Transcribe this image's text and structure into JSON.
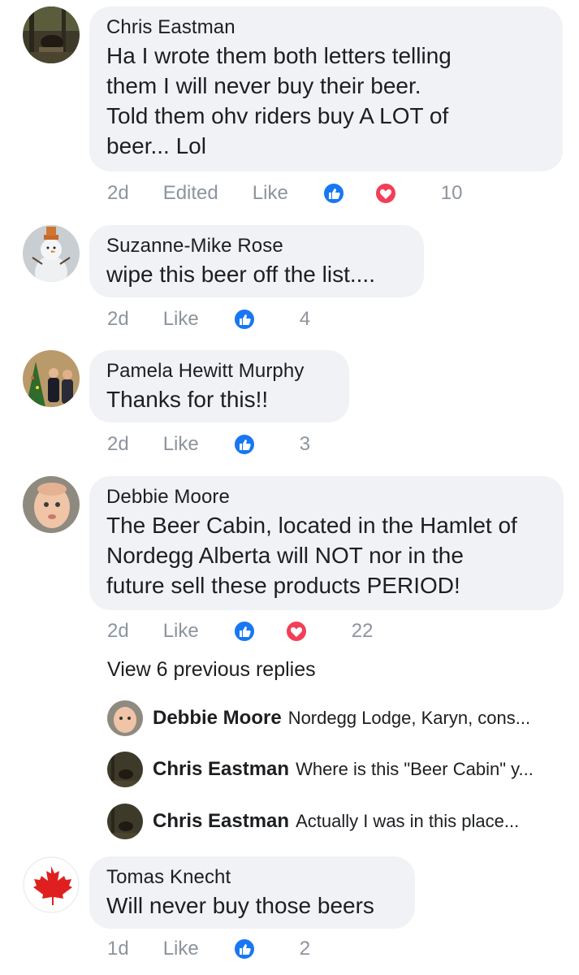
{
  "comments": [
    {
      "author": "Chris Eastman",
      "lines": [
        "Ha I wrote them both letters telling",
        "them I will never buy their beer.",
        "Told them ohv riders buy A LOT of",
        "beer... Lol"
      ],
      "time": "2d",
      "edited": "Edited",
      "like": "Like",
      "reaction_count": "10"
    },
    {
      "author": "Suzanne-Mike Rose",
      "lines": [
        "wipe this beer off the list...."
      ],
      "time": "2d",
      "like": "Like",
      "reaction_count": "4"
    },
    {
      "author": "Pamela Hewitt Murphy",
      "lines": [
        "Thanks for this!!"
      ],
      "time": "2d",
      "like": "Like",
      "reaction_count": "3"
    },
    {
      "author": "Debbie Moore",
      "lines": [
        "The Beer Cabin, located in the Hamlet of",
        "Nordegg Alberta will NOT nor in the",
        "future sell these products PERIOD!"
      ],
      "time": "2d",
      "like": "Like",
      "reaction_count": "22",
      "view_previous": "View 6 previous replies",
      "replies": [
        {
          "author": "Debbie Moore",
          "text": "Nordegg Lodge, Karyn, cons..."
        },
        {
          "author": "Chris Eastman",
          "text": "Where is this \"Beer Cabin\" y..."
        },
        {
          "author": "Chris Eastman",
          "text": "Actually I was in this place..."
        }
      ]
    },
    {
      "author": "Tomas Knecht",
      "lines": [
        "Will never buy those beers"
      ],
      "time": "1d",
      "like": "Like",
      "reaction_count": "2"
    }
  ],
  "icons": {
    "like": "like-reaction-icon",
    "love": "love-reaction-icon"
  },
  "colors": {
    "like_blue": "#1877f2",
    "love_red": "#f33e58",
    "bubble_bg": "#f0f2f5",
    "meta_gray": "#8d949e"
  }
}
